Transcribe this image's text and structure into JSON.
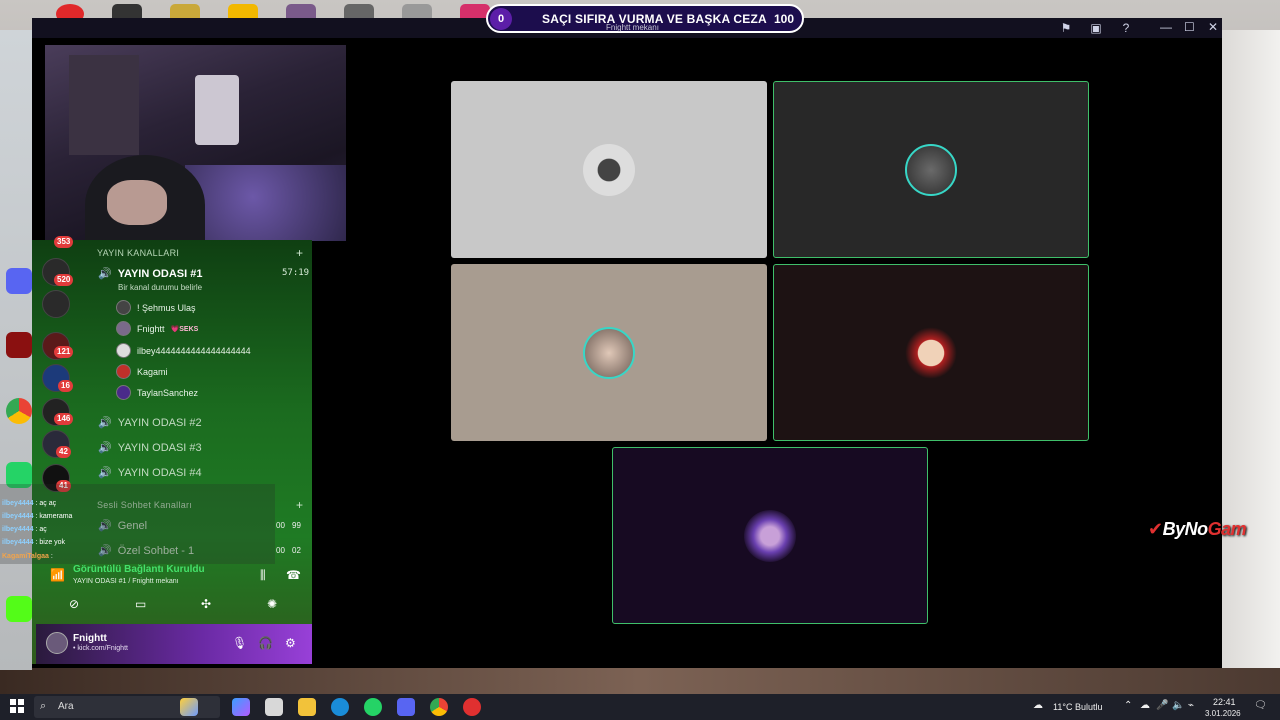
{
  "banner": {
    "left_value": "0",
    "title": "SAÇI SIFIRA VURMA VE BAŞKA CEZA",
    "goal_value": "100",
    "subtitle": "Fnightt mekanı"
  },
  "sidebar": {
    "section_stream": "YAYIN KANALLARI",
    "active_channel": {
      "name": "YAYIN ODASI #1",
      "time": "57:19",
      "status": "Bir kanal durumu belirle"
    },
    "members": [
      {
        "name": "! Şehmus Ulaş",
        "tag": ""
      },
      {
        "name": "Fnightt",
        "tag": "💗SEKS"
      },
      {
        "name": "ilbey4444444444444444444",
        "tag": ""
      },
      {
        "name": "Kagami",
        "tag": ""
      },
      {
        "name": "TaylanSanchez",
        "tag": ""
      }
    ],
    "channels": [
      "YAYIN ODASI #2",
      "YAYIN ODASI #3",
      "YAYIN ODASI #4"
    ],
    "section_voice": "Sesli Sohbet Kanalları",
    "voice_channels": [
      {
        "name": "Genel",
        "a": "00",
        "b": "99"
      },
      {
        "name": "Özel Sohbet - 1",
        "a": "00",
        "b": "02"
      }
    ],
    "server_badges": [
      "353",
      "520",
      "121",
      "16",
      "146",
      "42",
      "41"
    ]
  },
  "chat": [
    {
      "user": "ilbey4444",
      "msg": ": aç aç"
    },
    {
      "user": "ilbey4444",
      "msg": ": kamerama"
    },
    {
      "user": "ilbey4444",
      "msg": ": aç"
    },
    {
      "user": "ilbey4444",
      "msg": ": bize yok"
    },
    {
      "user": "KagamiTalgaa",
      "msg": ":"
    }
  ],
  "voice": {
    "title": "Görüntülü Bağlantı Kuruldu",
    "subtitle": "YAYIN ODASI #1 / Fnightt mekanı"
  },
  "user": {
    "name": "Fnightt",
    "sub": "• kick.com/Fnightt"
  },
  "brand": {
    "part1": "ByNo",
    "part2": "Gam"
  },
  "taskbar": {
    "search_placeholder": "Ara",
    "weather": "11°C  Bulutlu",
    "time": "22:41",
    "date": "3.01.2026"
  },
  "colors": {
    "accent_green": "#3fbf6a",
    "banner_bg": "#1c0d4d",
    "badge_red": "#e23b3b"
  }
}
